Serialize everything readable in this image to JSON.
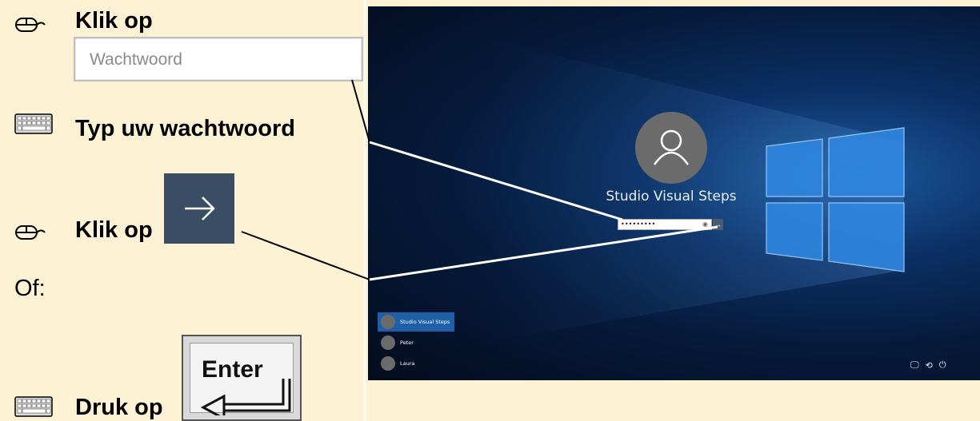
{
  "instructions": {
    "step1": {
      "icon": "mouse-icon",
      "text": "Klik op"
    },
    "password_field_sample": {
      "placeholder": "Wachtwoord"
    },
    "step2": {
      "icon": "keyboard-icon",
      "text": "Typ uw wachtwoord"
    },
    "step3": {
      "icon": "mouse-icon",
      "text": "Klik op",
      "button_icon": "right-arrow-icon"
    },
    "or_label": "Of:",
    "step4": {
      "icon": "keyboard-icon",
      "text": "Druk op",
      "key_label": "Enter"
    }
  },
  "login_screen": {
    "username": "Studio Visual Steps",
    "password_value": "•••••••••",
    "users": [
      "Studio Visual Steps",
      "Peter",
      "Laura"
    ],
    "tray_icons": [
      "network-icon",
      "ease-of-access-icon",
      "power-icon"
    ]
  },
  "colors": {
    "background": "#fdf3d4",
    "arrow_tile": "#3a4d65",
    "selected_user": "#1f5fa8"
  }
}
